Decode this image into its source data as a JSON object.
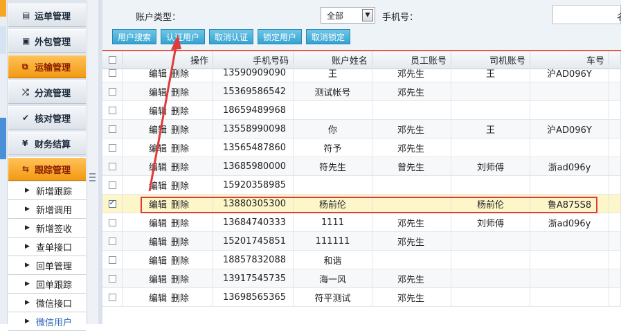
{
  "sidebar": {
    "menus": [
      {
        "icon": "document-icon",
        "glyph": "▤",
        "label": "运单管理",
        "active": false
      },
      {
        "icon": "briefcase-icon",
        "glyph": "▣",
        "label": "外包管理",
        "active": false
      },
      {
        "icon": "transport-icon",
        "glyph": "⧉",
        "label": "运输管理",
        "active": true
      },
      {
        "icon": "shuffle-icon",
        "glyph": "⤮",
        "label": "分流管理",
        "active": false
      },
      {
        "icon": "check-icon",
        "glyph": "✔",
        "label": "核对管理",
        "active": false
      },
      {
        "icon": "yen-icon",
        "glyph": "¥",
        "label": "财务结算",
        "active": false
      },
      {
        "icon": "refresh-icon",
        "glyph": "⇆",
        "label": "跟踪管理",
        "active": true
      }
    ],
    "submenu": [
      "新增跟踪",
      "新增调用",
      "新增签收",
      "查单接口",
      "回单管理",
      "回单跟踪",
      "微信接口",
      "微信用户"
    ]
  },
  "filter": {
    "account_type_label": "账户类型：",
    "account_type_value": "全部",
    "phone_label": "手机号：",
    "phone_value": "",
    "cut_label": "彳"
  },
  "toolbar": {
    "buttons": [
      "用户搜索",
      "认证用户",
      "取消认证",
      "锁定用户",
      "取消锁定"
    ]
  },
  "table": {
    "headers": [
      "",
      "操作",
      "手机号码",
      "账户姓名",
      "员工账号",
      "司机账号",
      "车号"
    ],
    "edit_label": "编辑",
    "delete_label": "删除",
    "rows": [
      {
        "checked": false,
        "phone": "13590909090",
        "name": "王",
        "staff": "邓先生",
        "driver": "王",
        "plate": "沪AD096Y"
      },
      {
        "checked": false,
        "phone": "15369586542",
        "name": "测试帐号",
        "staff": "邓先生",
        "driver": "",
        "plate": ""
      },
      {
        "checked": false,
        "phone": "18659489968",
        "name": "",
        "staff": "",
        "driver": "",
        "plate": ""
      },
      {
        "checked": false,
        "phone": "13558990098",
        "name": "你",
        "staff": "邓先生",
        "driver": "王",
        "plate": "沪AD096Y"
      },
      {
        "checked": false,
        "phone": "13565487860",
        "name": "符予",
        "staff": "邓先生",
        "driver": "",
        "plate": ""
      },
      {
        "checked": false,
        "phone": "13685980000",
        "name": "符先生",
        "staff": "曾先生",
        "driver": "刘师傅",
        "plate": "浙ad096y"
      },
      {
        "checked": false,
        "phone": "15920358985",
        "name": "",
        "staff": "",
        "driver": "",
        "plate": ""
      },
      {
        "checked": true,
        "phone": "13880305300",
        "name": "杨前伦",
        "staff": "",
        "driver": "杨前伦",
        "plate": "鲁A875S8"
      },
      {
        "checked": false,
        "phone": "13684740333",
        "name": "1111",
        "staff": "邓先生",
        "driver": "刘师傅",
        "plate": "浙ad096y"
      },
      {
        "checked": false,
        "phone": "15201745851",
        "name": "111111",
        "staff": "邓先生",
        "driver": "",
        "plate": ""
      },
      {
        "checked": false,
        "phone": "18857832088",
        "name": "和谐",
        "staff": "",
        "driver": "",
        "plate": ""
      },
      {
        "checked": false,
        "phone": "13917545735",
        "name": "海一风",
        "staff": "邓先生",
        "driver": "",
        "plate": ""
      },
      {
        "checked": false,
        "phone": "13698565365",
        "name": "符平测试",
        "staff": "邓先生",
        "driver": "",
        "plate": ""
      }
    ]
  },
  "annotation": {
    "color": "#e03a3a"
  }
}
